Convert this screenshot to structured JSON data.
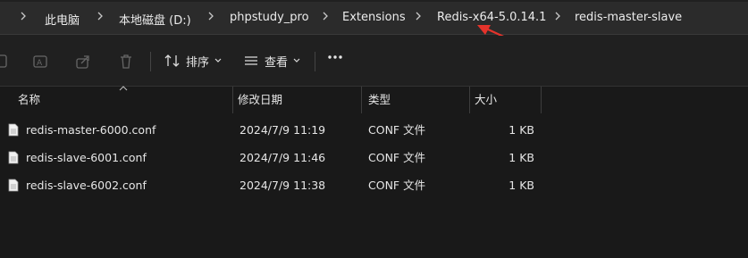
{
  "breadcrumb": {
    "items": [
      "此电脑",
      "本地磁盘 (D:)",
      "phpstudy_pro",
      "Extensions",
      "Redis-x64-5.0.14.1",
      "redis-master-slave"
    ]
  },
  "toolbar": {
    "sort_label": "排序",
    "view_label": "查看",
    "more_label": "•••"
  },
  "columns": {
    "name": "名称",
    "modified": "修改日期",
    "type": "类型",
    "size": "大小"
  },
  "files": [
    {
      "name": "redis-master-6000.conf",
      "modified": "2024/7/9 11:19",
      "type": "CONF 文件",
      "size": "1 KB"
    },
    {
      "name": "redis-slave-6001.conf",
      "modified": "2024/7/9 11:46",
      "type": "CONF 文件",
      "size": "1 KB"
    },
    {
      "name": "redis-slave-6002.conf",
      "modified": "2024/7/9 11:38",
      "type": "CONF 文件",
      "size": "1 KB"
    }
  ],
  "colors": {
    "background": "#191919",
    "bar": "#2b2b2b",
    "annotation_arrow": "#e5332b"
  }
}
